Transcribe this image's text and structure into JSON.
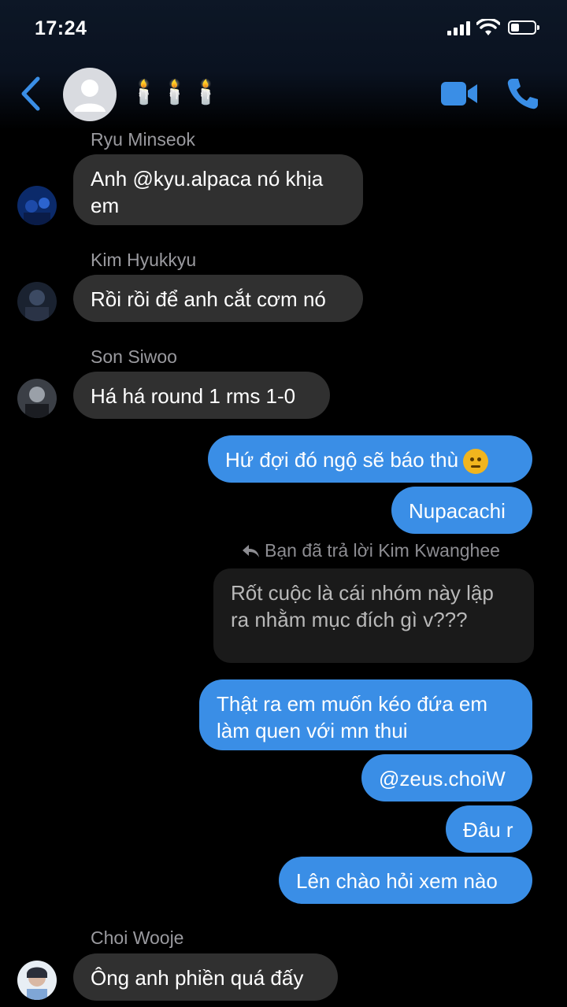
{
  "status_bar": {
    "time": "17:24"
  },
  "header": {
    "title": "🕯️🕯️🕯️"
  },
  "messages": {
    "m1": {
      "sender": "Ryu Minseok",
      "text": "Anh @kyu.alpaca nó khịa em"
    },
    "m2": {
      "sender": "Kim Hyukkyu",
      "text": "Rồi rồi để anh cắt cơm nó"
    },
    "m3": {
      "sender": "Son Siwoo",
      "text": "Há há round 1 rms 1-0"
    },
    "m4": {
      "text": "Hứ đợi đó ngộ sẽ báo thù"
    },
    "m5": {
      "text": "Nupacachi"
    },
    "reply_note": "Bạn đã trả lời Kim Kwanghee",
    "reply_quote": "Rốt cuộc là cái nhóm này lập ra nhằm mục đích gì v???",
    "m6": {
      "text": "Thật ra em muốn kéo đứa em làm quen với mn thui"
    },
    "m7": {
      "text": "@zeus.choiW"
    },
    "m8": {
      "text": "Đâu r"
    },
    "m9": {
      "text": "Lên chào hỏi xem nào"
    },
    "m10": {
      "sender": "Choi Wooje",
      "text": "Ông anh phiền quá đấy"
    }
  },
  "colors": {
    "accent": "#3a8ee6",
    "incoming": "#303030",
    "background": "#000000"
  }
}
